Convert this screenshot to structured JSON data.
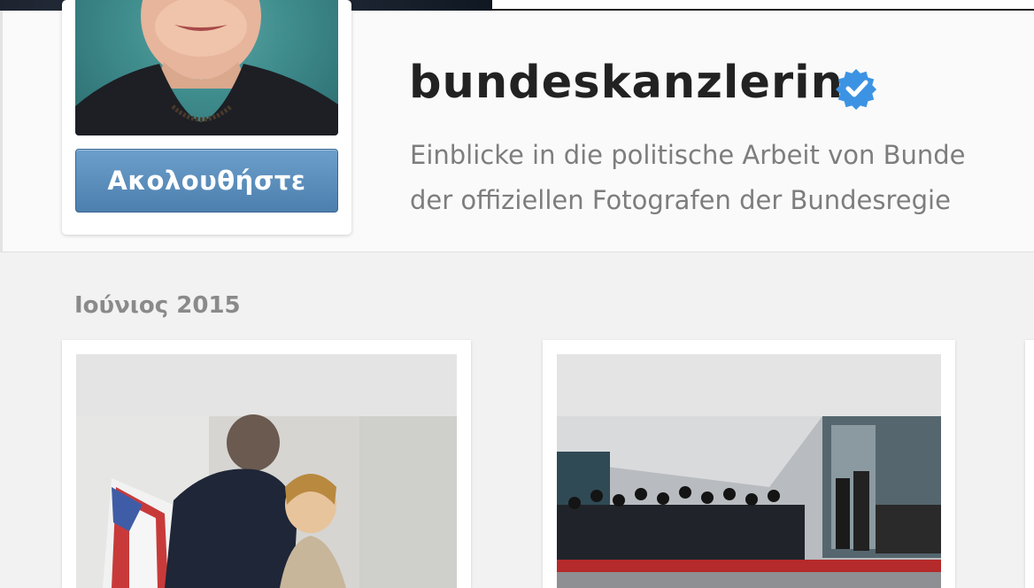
{
  "profile": {
    "username": "bundeskanzlerin",
    "verified": true,
    "follow_label": "Ακολουθήστε",
    "bio_lines": [
      "Einblicke in die politische Arbeit von Bunde",
      "der offiziellen Fotografen der Bundesregie"
    ]
  },
  "feed": {
    "month_label": "Ιούνιος 2015",
    "posts": [
      {
        "name": "post-1",
        "description_icon": "photo-thumbnail"
      },
      {
        "name": "post-2",
        "description_icon": "photo-thumbnail"
      }
    ]
  },
  "colors": {
    "follow_button": "#5a8bba",
    "verified_badge": "#3897f0",
    "username_text": "#222222",
    "bio_text": "#7d7d7d"
  }
}
